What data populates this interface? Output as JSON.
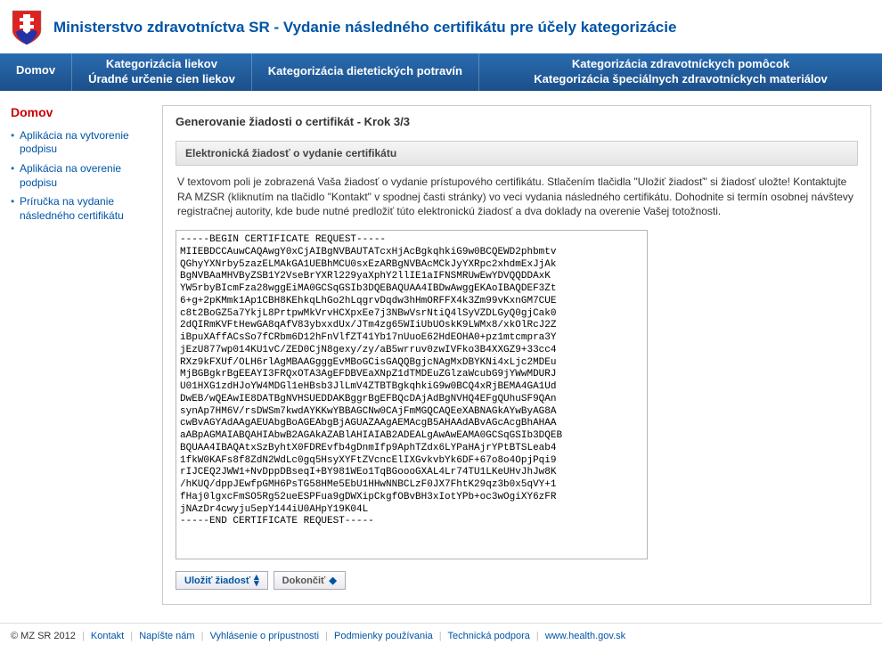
{
  "header": {
    "title": "Ministerstvo zdravotníctva SR - Vydanie následného certifikátu pre účely kategorizácie"
  },
  "nav": {
    "home": "Domov",
    "item2_line1": "Kategorizácia liekov",
    "item2_line2": "Úradné určenie cien liekov",
    "item3_line1": "Kategorizácia dietetických potravín",
    "item4_line1": "Kategorizácia zdravotníckych pomôcok",
    "item4_line2": "Kategorizácia špeciálnych zdravotníckych materiálov"
  },
  "sidebar": {
    "title": "Domov",
    "items": [
      {
        "label": "Aplikácia na vytvorenie podpisu"
      },
      {
        "label": "Aplikácia na overenie podpisu"
      },
      {
        "label": "Príručka na vydanie následného certifikátu"
      }
    ]
  },
  "main": {
    "heading": "Generovanie žiadosti o certifikát - Krok 3/3",
    "section_title": "Elektronická žiadosť o vydanie certifikátu",
    "instructions": "V textovom poli je zobrazená Vaša žiadosť o vydanie prístupového certifikátu. Stlačením tlačidla \"Uložiť žiadosť\" si žiadosť uložte! Kontaktujte RA MZSR (kliknutím na tlačidlo \"Kontakt\" v spodnej časti stránky) vo veci vydania následného certifikátu. Dohodnite si termín osobnej návštevy registračnej autority, kde bude nutné predložiť túto elektronickú žiadosť a dva doklady na overenie Vašej totožnosti.",
    "certificate_request": "-----BEGIN CERTIFICATE REQUEST-----\nMIIEBDCCAuwCAQAwgY0xCjAIBgNVBAUTATcxHjAcBgkqhkiG9w0BCQEWD2phbmtv\nQGhyYXNrby5zazELMAkGA1UEBhMCU0sxEzARBgNVBAcMCkJyYXRpc2xhdmExJjAk\nBgNVBAaMHVByZSB1Y2VseBrYXRl229yaXphY2llIE1aIFNSMRUwEwYDVQQDDAxK\nYW5rbyBIcmFza28wggEiMA0GCSqGSIb3DQEBAQUAA4IBDwAwggEKAoIBAQDEF3Zt\n6+g+2pKMmk1Ap1CBH8KEhkqLhGo2hLqgrvDqdw3hHmORFFX4k3Zm99vKxnGM7CUE\nc8t2BoGZ5a7YkjL8PrtpwMkVrvHCXpxEe7j3NBwVsrNtiQ4lSyVZDLGyQ0gjCak0\n2dQIRmKVFtHewGA8qAfV83ybxxdUx/JTm4zg65WIiUbUOskK9LWMx8/xkOlRcJ2Z\niBpuXAffACsSo7fCRbm6D12hFnVlfZT41Yb17nUuoE62HdEOHA0+pz1mtcmpra3Y\njEzU877wp014KU1vC/ZED0CjN8gexy/zy/aB5wrruv0zwIVFko3B4XXGZ9+33cc4\nRXz9kFXUf/OLH6rlAgMBAAGgggEvMBoGCisGAQQBgjcNAgMxDBYKNi4xLjc2MDEu\nMjBGBgkrBgEEAYI3FRQxOTA3AgEFDBVEaXNpZ1dTMDEuZGlzaWcubG9jYWwMDURJ\nU01HXG1zdHJoYW4MDGl1eHBsb3JlLmV4ZTBTBgkqhkiG9w0BCQ4xRjBEMA4GA1Ud\nDwEB/wQEAwIE8DATBgNVHSUEDDAKBggrBgEFBQcDAjAdBgNVHQ4EFgQUhuSF9QAn\nsynAp7HM6V/rsDWSm7kwdAYKKwYBBAGCNw0CAjFmMGQCAQEeXABNAGkAYwByAG8A\ncwBvAGYAdAAgAEUAbgBoAGEAbgBjAGUAZAAgAEMAcgB5AHAAdABvAGcAcgBhAHAA\naABpAGMAIABQAHIAbwB2AGAkAZABlAHIAIAB2ADEALgAwAwEAMA0GCSqGSIb3DQEB\nBQUAA4IBAQAtxSzByhtX0FDREvfb4gDnmIfp9AphTZdx6LYPaHAjrYPtBTSLeab4\n1fkW0KAFs8f8ZdN2WdLc0gq5HsyXYFtZVcncElIXGvkvbYk6DF+67o8o4OpjPqi9\nrIJCEQ2JWW1+NvDppDBseqI+BY981WEo1TqBGoooGXAL4Lr74TU1LKeUHvJhJw8K\n/hKUQ/dppJEwfpGMH6PsTG58HMe5EbU1HHwNNBCLzF0JX7FhtK29qz3b0x5qVY+1\nfHaj0lgxcFmSO5Rg52ueESPFua9gDWXipCkgfOBvBH3xIotYPb+oc3wOgiXY6zFR\njNAzDr4cwyju5epY144iU0AHpY19K04L\n-----END CERTIFICATE REQUEST-----",
    "save_label": "Uložiť žiadosť",
    "finish_label": "Dokončiť"
  },
  "footer": {
    "copyright": "© MZ SR 2012",
    "links": [
      "Kontakt",
      "Napíšte nám",
      "Vyhlásenie o prípustnosti",
      "Podmienky používania",
      "Technická podpora",
      "www.health.gov.sk"
    ]
  }
}
